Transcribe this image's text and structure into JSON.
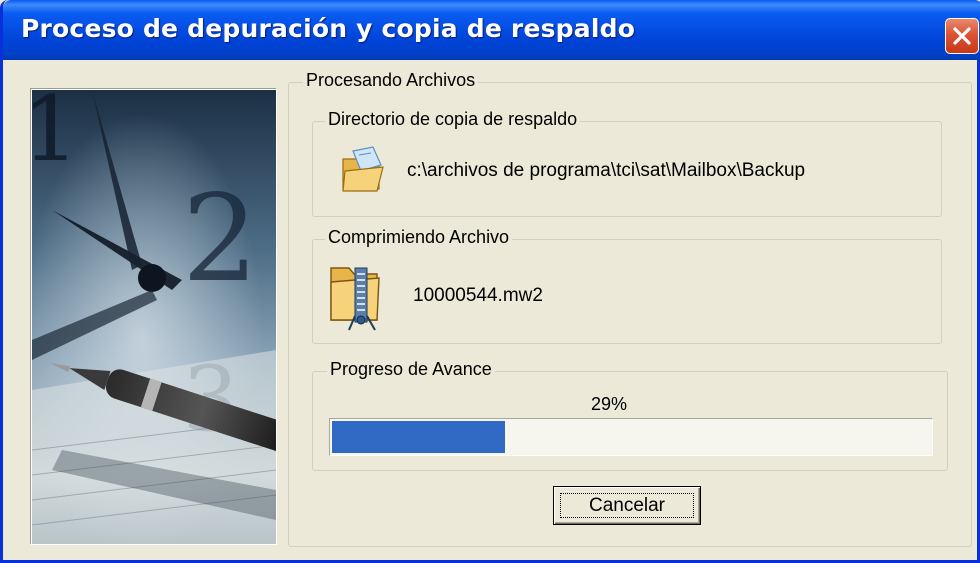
{
  "window": {
    "title": "Proceso de depuración y copia de respaldo"
  },
  "outer_group": {
    "legend": "Procesando Archivos"
  },
  "directory_group": {
    "legend": "Directorio de copia de respaldo",
    "path": "c:\\archivos de programa\\tci\\sat\\Mailbox\\Backup",
    "icon": "folder-icon"
  },
  "file_group": {
    "legend": "Comprimiendo Archivo",
    "file_name": "10000544.mw2",
    "icon": "zipped-folder-icon"
  },
  "progress_group": {
    "legend": "Progreso de Avance",
    "percent_text": "29%",
    "progress_fraction": 0.29
  },
  "buttons": {
    "cancel_label": "Cancelar"
  },
  "colors": {
    "titlebar": "#0a5cf2",
    "progress_fill": "#316ac5",
    "dialog_bg": "#ece9d8"
  }
}
